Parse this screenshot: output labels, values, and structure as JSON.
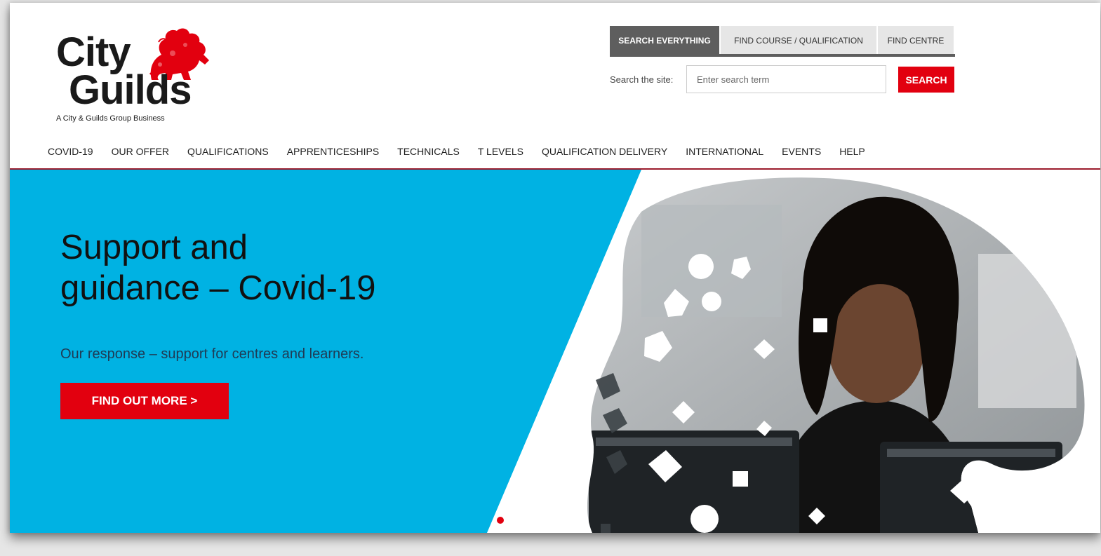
{
  "logo": {
    "line1": "City",
    "line2": "Guilds",
    "tagline": "A City & Guilds Group Business",
    "icon": "lion-icon"
  },
  "search": {
    "tabs": [
      {
        "label": "SEARCH EVERYTHING",
        "active": true
      },
      {
        "label": "FIND COURSE / QUALIFICATION",
        "active": false
      },
      {
        "label": "FIND CENTRE",
        "active": false
      }
    ],
    "label": "Search the site:",
    "placeholder": "Enter search term",
    "button": "SEARCH"
  },
  "nav": {
    "items": [
      "COVID-19",
      "OUR OFFER",
      "QUALIFICATIONS",
      "APPRENTICESHIPS",
      "TECHNICALS",
      "T LEVELS",
      "QUALIFICATION DELIVERY",
      "INTERNATIONAL",
      "EVENTS",
      "HELP"
    ]
  },
  "hero": {
    "title_line1": "Support and",
    "title_line2": "guidance – Covid-19",
    "subtitle": "Our response – support for centres and learners.",
    "cta": "FIND OUT MORE >"
  },
  "colors": {
    "brand_red": "#e2000f",
    "hero_blue": "#00b2e3",
    "nav_rule": "#9b1b2c",
    "tab_active": "#5e5e5e",
    "tab_inactive": "#e6e6e6"
  }
}
